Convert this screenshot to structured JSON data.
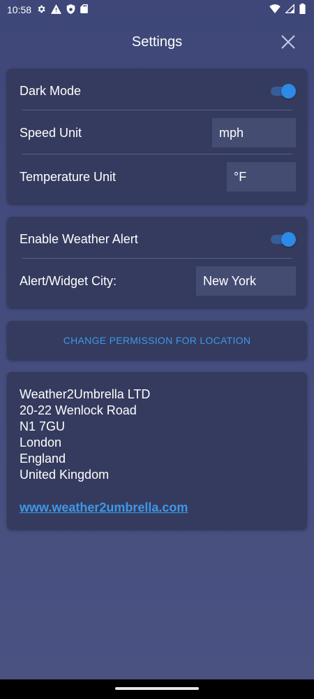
{
  "status_bar": {
    "time": "10:58",
    "left_icons": [
      "gear-icon",
      "warning-icon",
      "shield-icon",
      "sd-card-icon"
    ],
    "right_icons": [
      "wifi-icon",
      "signal-icon",
      "battery-icon"
    ]
  },
  "header": {
    "title": "Settings"
  },
  "display_settings": {
    "dark_mode_label": "Dark Mode",
    "dark_mode_on": true,
    "speed_unit_label": "Speed Unit",
    "speed_unit_value": "mph",
    "temperature_unit_label": "Temperature Unit",
    "temperature_unit_value": "°F"
  },
  "alert_settings": {
    "enable_alert_label": "Enable Weather Alert",
    "enable_alert_on": true,
    "city_label": "Alert/Widget City:",
    "city_value": "New York"
  },
  "location": {
    "permission_button_label": "CHANGE PERMISSION FOR LOCATION"
  },
  "company": {
    "address_lines": [
      "Weather2Umbrella LTD",
      "20-22 Wenlock Road",
      "N1 7GU",
      "London",
      "England",
      "United Kingdom"
    ],
    "website": "www.weather2umbrella.com"
  },
  "colors": {
    "accent": "#2d8ae6",
    "link": "#3d98e8",
    "card": "#353b5e",
    "background": "#424a7b"
  }
}
